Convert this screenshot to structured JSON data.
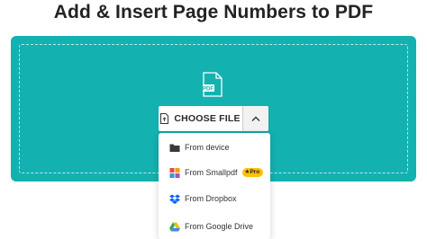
{
  "page": {
    "title": "Add & Insert Page Numbers to PDF"
  },
  "upload": {
    "file_icon_label": "PDF",
    "choose_label": "CHOOSE FILE",
    "menu": [
      {
        "label": "From device",
        "icon": "folder-icon"
      },
      {
        "label": "From Smallpdf",
        "icon": "smallpdf-icon",
        "badge": "Pro"
      },
      {
        "label": "From Dropbox",
        "icon": "dropbox-icon"
      },
      {
        "label": "From Google Drive",
        "icon": "google-drive-icon"
      }
    ]
  },
  "colors": {
    "accent": "#14b1b1",
    "badge": "#ffc107"
  }
}
